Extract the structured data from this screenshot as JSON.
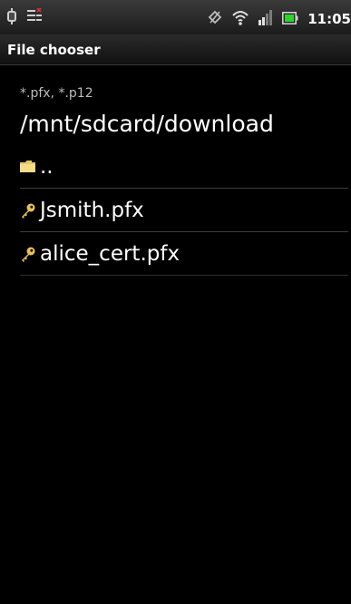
{
  "status_bar": {
    "time": "11:05",
    "icons": [
      "android-debug-icon",
      "notification-icon",
      "sync-off-icon",
      "wifi-icon",
      "signal-icon",
      "battery-icon"
    ],
    "battery_color": "#2bd42b"
  },
  "title_bar": {
    "title": "File chooser"
  },
  "chooser": {
    "filter": "*.pfx, *.p12",
    "current_path": "/mnt/sdcard/download",
    "items": [
      {
        "label": "..",
        "icon": "folder-icon"
      },
      {
        "label": "Jsmith.pfx",
        "icon": "key-icon"
      },
      {
        "label": "alice_cert.pfx",
        "icon": "key-icon"
      }
    ]
  },
  "colors": {
    "background": "#000000",
    "folder_icon": "#e6c86a",
    "key_icon": "#e8c15c"
  }
}
